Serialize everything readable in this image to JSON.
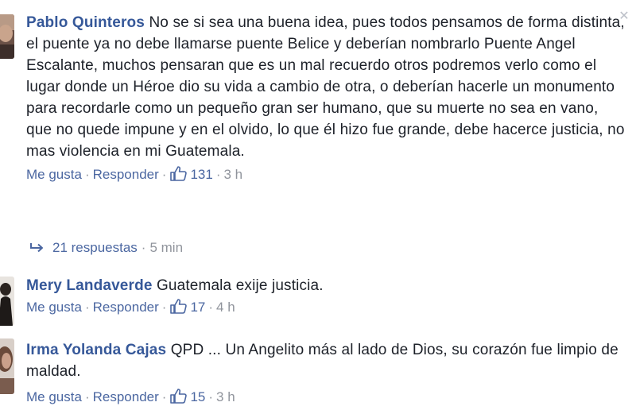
{
  "comments": [
    {
      "author": "Pablo Quinteros",
      "text": "No se si sea una buena idea, pues todos pensamos de forma distinta, el puente ya no debe llamarse puente Belice y deberían nombrarlo Puente Angel Escalante, muchos pensaran que es un mal recuerdo otros podremos verlo como el lugar donde un Héroe dio su vida a cambio de otra, o deberían hacerle un monumento para recordarle como un pequeño gran ser humano, que su muerte no sea en vano, que no quede impune y en el olvido, lo que él hizo fue grande, debe hacerce justicia, no mas violencia en mi Guatemala.",
      "like_label": "Me gusta",
      "reply_label": "Responder",
      "likes": "131",
      "time": "3 h",
      "replies": {
        "count_label": "21 respuestas",
        "time": "5 min"
      }
    },
    {
      "author": "Mery Landaverde",
      "text": "Guatemala exije justicia.",
      "like_label": "Me gusta",
      "reply_label": "Responder",
      "likes": "17",
      "time": "4 h"
    },
    {
      "author": "Irma Yolanda Cajas",
      "text": "QPD ... Un Angelito más al lado de Dios, su corazón fue limpio de maldad.",
      "like_label": "Me gusta",
      "reply_label": "Responder",
      "likes": "15",
      "time": "3 h"
    }
  ],
  "separator": "·",
  "icons": {
    "like": "thumbs-up-icon",
    "reply": "reply-arrow-icon",
    "close": "close-icon"
  },
  "colors": {
    "link": "#365899",
    "meta": "#90949c",
    "text": "#1d2129"
  }
}
